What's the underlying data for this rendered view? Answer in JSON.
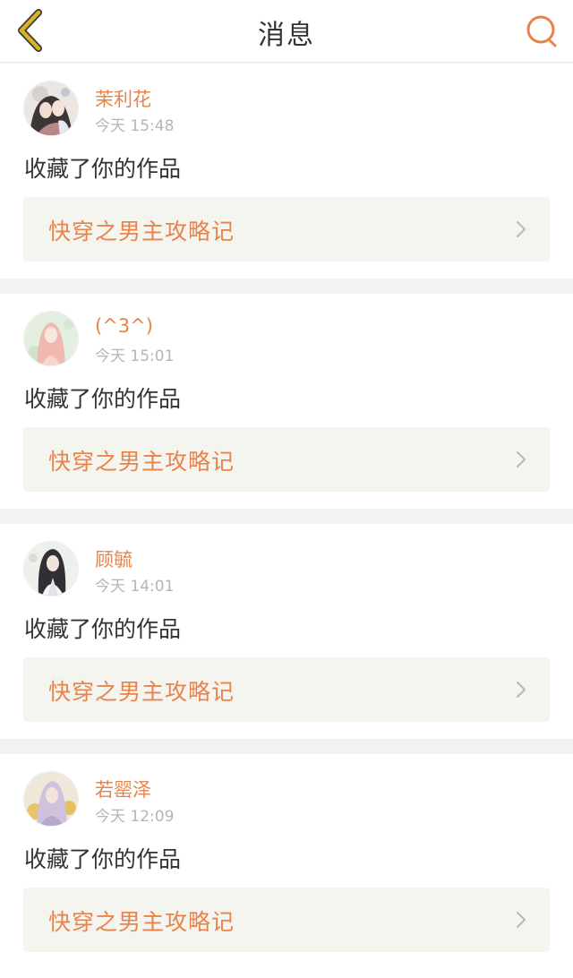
{
  "header": {
    "title": "消息",
    "back_icon": "chevron-left-icon",
    "search_icon": "search-icon"
  },
  "colors": {
    "accent": "#e8834c",
    "back_icon": "#d9b422",
    "text": "#333333",
    "muted": "#b5b5b5",
    "work_box_bg": "#f5f5f0",
    "separator": "#f2f2f2"
  },
  "notifications": [
    {
      "username": "茉利花",
      "time": "今天 15:48",
      "action": "收藏了你的作品",
      "work_title": "快穿之男主攻略记"
    },
    {
      "username": "(^3^)",
      "time": "今天 15:01",
      "action": "收藏了你的作品",
      "work_title": "快穿之男主攻略记"
    },
    {
      "username": "顾毓",
      "time": "今天 14:01",
      "action": "收藏了你的作品",
      "work_title": "快穿之男主攻略记"
    },
    {
      "username": "若罂泽",
      "time": "今天 12:09",
      "action": "收藏了你的作品",
      "work_title": "快穿之男主攻略记"
    }
  ]
}
